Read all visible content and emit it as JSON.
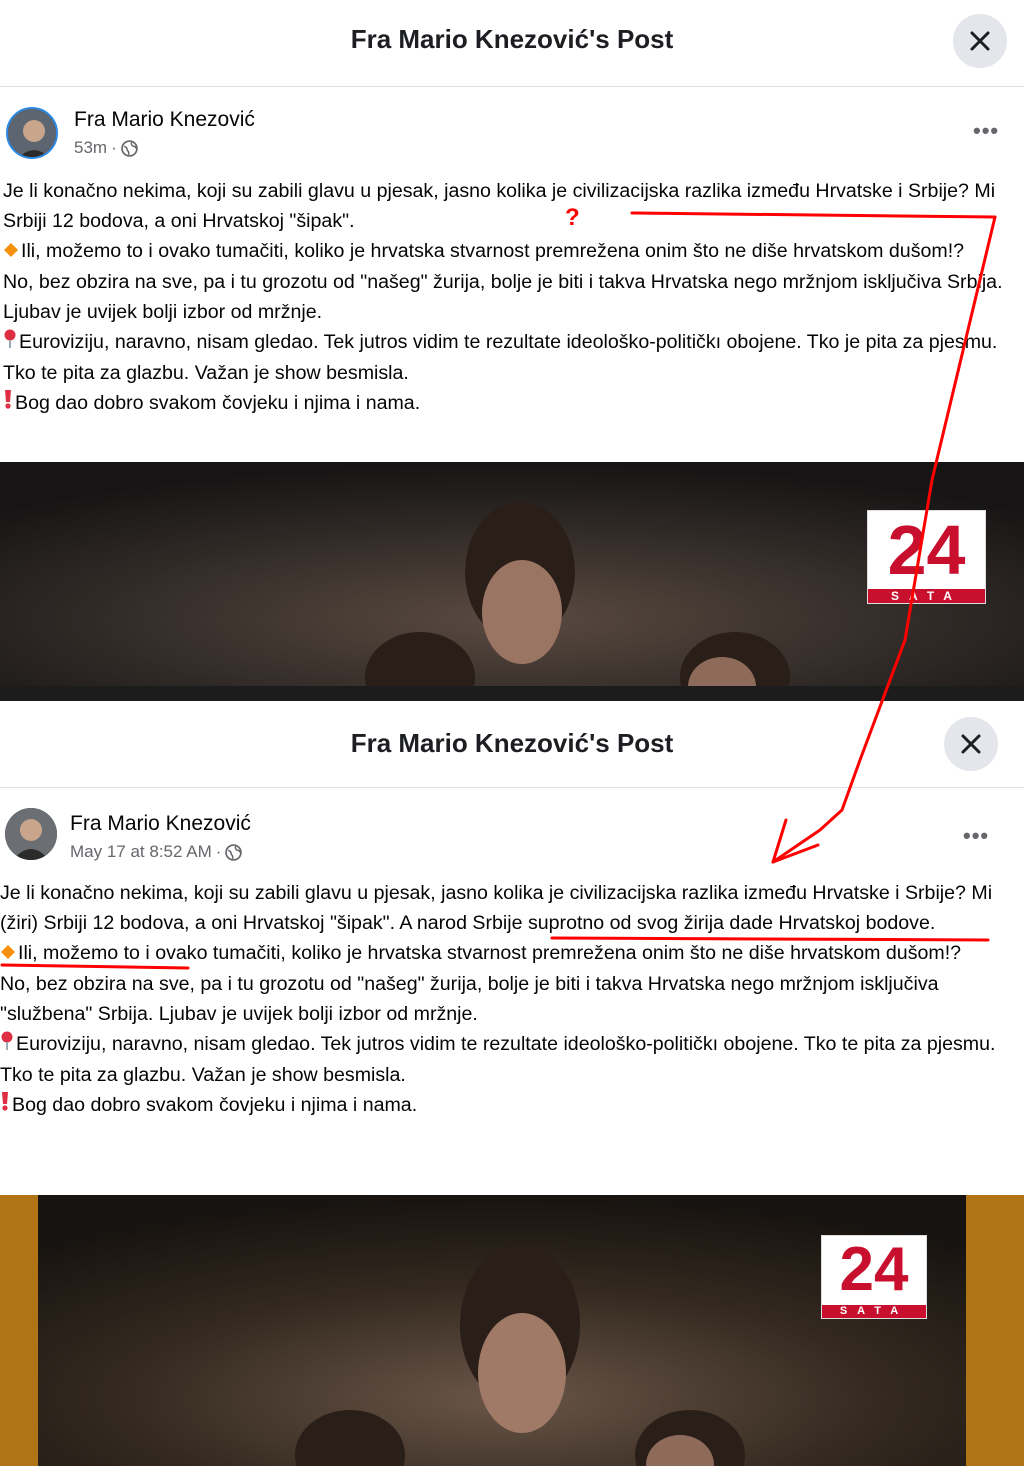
{
  "screenshots": [
    {
      "header_title": "Fra Mario Knezović's Post",
      "author": "Fra Mario Knezović",
      "time": "53m",
      "paragraphs": [
        "Je li konačno nekima, koji su zabili glavu u pjesak, jasno kolika je civilizacijska razlika između Hrvatske i Srbije? Mi Srbiji 12 bodova, a oni Hrvatskoj \"šipak\".",
        "Ili, možemo to i ovako tumačiti, koliko je hrvatska stvarnost premrežena onim što ne diše hrvatskom dušom!?",
        "No, bez obzira na sve, pa i tu grozotu od \"našeg\" žurija, bolje je biti i takva Hrvatska nego mržnjom isključiva Srbija. Ljubav je uvijek bolji izbor od mržnje.",
        "Euroviziju, naravno, nisam gledao. Tek jutros vidim te rezultate ideološko-političkı obojene. Tko je pita za pjesmu. Tko te pita za glazbu. Važan je show besmisla.",
        "Bog dao dobro svakom čovjeku i njima i nama."
      ],
      "logo_number": "24",
      "logo_word": "SATA"
    },
    {
      "header_title": "Fra Mario Knezović's Post",
      "author": "Fra Mario Knezović",
      "time": "May 17 at 8:52 AM",
      "p1_start": "Je li konačno nekima, koji su zabili glavu u pjesak, jasno kolika je civilizacijska razlika između Hrvatske i Srbije? Mi (žiri) Srbiji 12 bodova, a oni Hrvatskoj \"šipak\". ",
      "p1_added": "A narod Srbije suprotno od svog žirija dade Hrvatskoj bodove.",
      "paragraphs": [
        "Ili, možemo to i ovako tumačiti, koliko je hrvatska stvarnost premrežena onim što ne diše hrvatskom dušom!?",
        "No, bez obzira na sve, pa i tu grozotu od \"našeg\" žurija, bolje je biti i takva Hrvatska nego mržnjom isključiva \"službena\" Srbija. Ljubav je uvijek bolji izbor od mržnje.",
        "Euroviziju, naravno, nisam gledao. Tek jutros vidim te rezultate ideološko-političkı obojene. Tko te pita za pjesmu. Tko te pita za glazbu. Važan je show besmisla.",
        "Bog dao dobro svakom čovjeku i njima i nama."
      ],
      "logo_number": "24",
      "logo_word": "SATA"
    }
  ],
  "annotation": {
    "question_mark": "?",
    "color": "#ff0000"
  },
  "icons": {
    "close": "close-icon",
    "globe": "globe-icon",
    "more": "more-options-icon",
    "diamond": "orange-diamond-icon",
    "pin": "round-pushpin-icon",
    "exclamation": "red-exclamation-icon"
  }
}
